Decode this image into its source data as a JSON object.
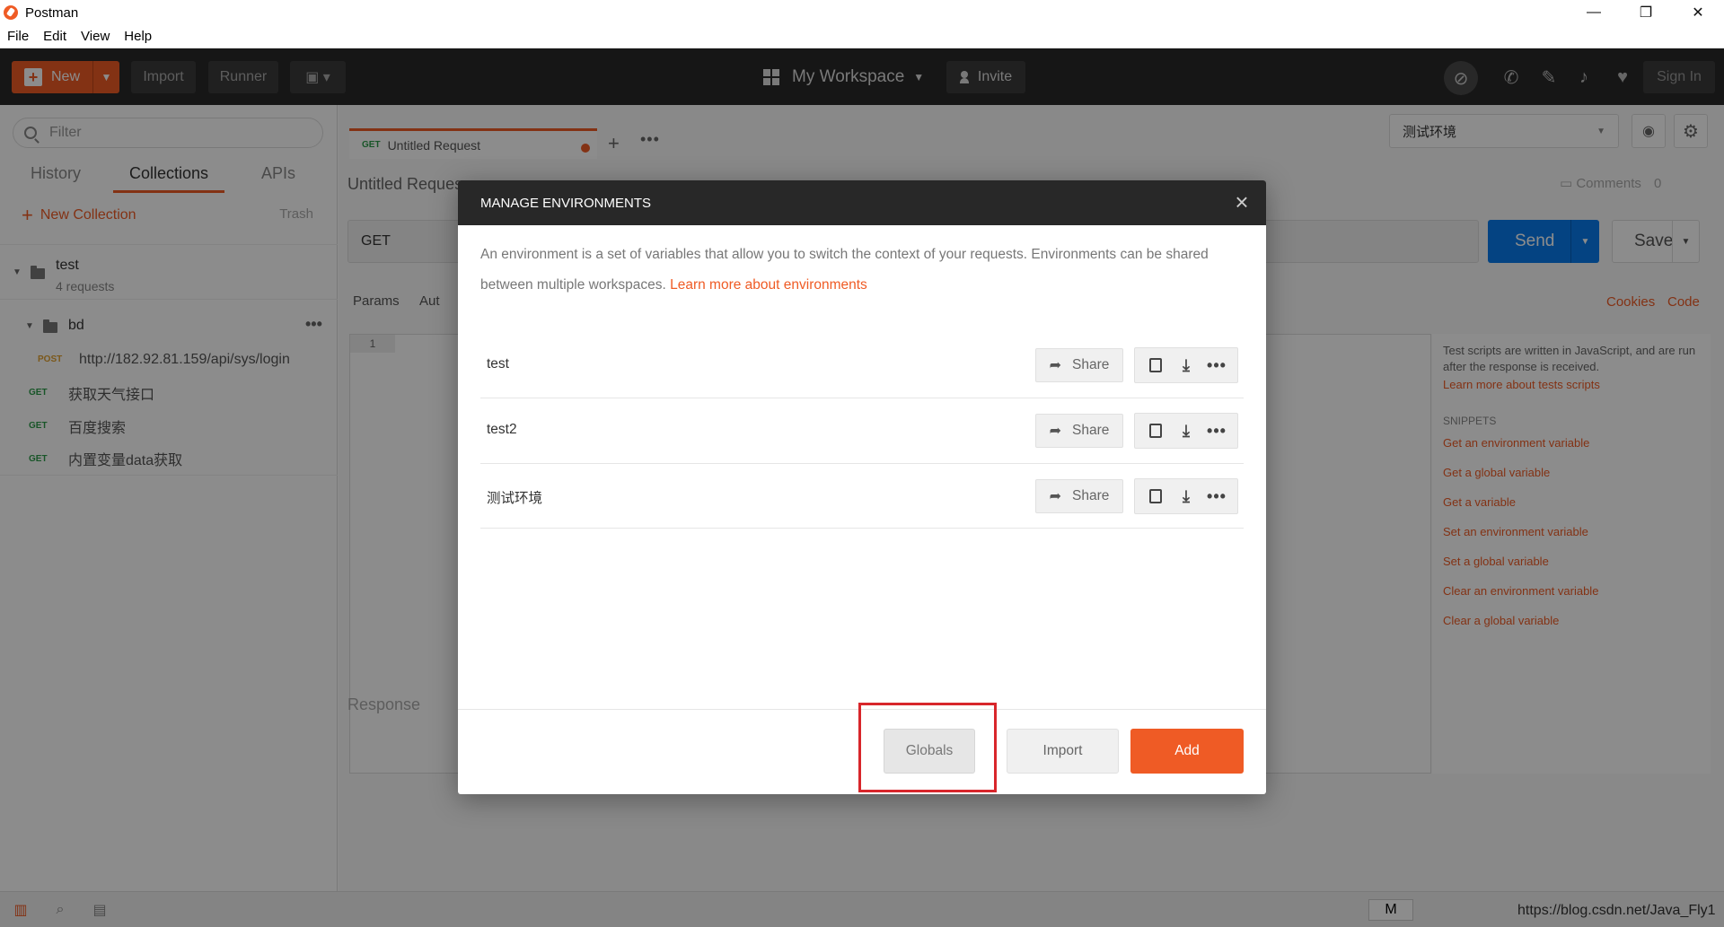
{
  "window": {
    "title": "Postman",
    "controls": [
      "—",
      "❐",
      "✕"
    ]
  },
  "menu": [
    "File",
    "Edit",
    "View",
    "Help"
  ],
  "header": {
    "new_label": "New",
    "import_label": "Import",
    "runner_label": "Runner",
    "workspace_label": "My Workspace",
    "invite_label": "Invite",
    "signin_label": "Sign In"
  },
  "sidebar": {
    "filter_placeholder": "Filter",
    "tabs": [
      "History",
      "Collections",
      "APIs"
    ],
    "active_tab": "Collections",
    "new_collection_label": "New Collection",
    "trash_label": "Trash",
    "collection": {
      "name": "test",
      "count": "4 requests",
      "folder": "bd",
      "requests": [
        {
          "method": "POST",
          "name": "http://182.92.81.159/api/sys/login"
        },
        {
          "method": "GET",
          "name": "获取天气接口"
        },
        {
          "method": "GET",
          "name": "百度搜索"
        },
        {
          "method": "GET",
          "name": "内置变量data获取"
        }
      ]
    }
  },
  "main": {
    "tab_method": "GET",
    "tab_label": "Untitled Request",
    "request_title": "Untitled Reques",
    "environment_selected": "测试环境",
    "comments_label": "Comments",
    "comments_count": "0",
    "url_method": "GET",
    "send_label": "Send",
    "save_label": "Save",
    "params_label": "Params",
    "auth_label": "Aut",
    "cookies_label": "Cookies",
    "code_label": "Code",
    "line_number": "1",
    "response_label": "Response",
    "snippets": {
      "description": "Test scripts are written in JavaScript, and are run after the response is received.",
      "learn_more": "Learn more about tests scripts",
      "heading": "SNIPPETS",
      "items": [
        "Get an environment variable",
        "Get a global variable",
        "Get a variable",
        "Set an environment variable",
        "Set a global variable",
        "Clear an environment variable",
        "Clear a global variable"
      ]
    }
  },
  "modal": {
    "title": "MANAGE ENVIRONMENTS",
    "description": "An environment is a set of variables that allow you to switch the context of your requests. Environments can be shared between multiple workspaces.",
    "learn_more": "Learn more about environments",
    "share_label": "Share",
    "environments": [
      "test",
      "test2",
      "测试环境"
    ],
    "globals_label": "Globals",
    "import_label": "Import",
    "add_label": "Add"
  },
  "bottom": {
    "badge": "M",
    "watermark": "https://blog.csdn.net/Java_Fly1"
  },
  "colors": {
    "accent": "#ef5b25",
    "send_blue": "#097bed",
    "header_dark": "#282828",
    "highlight_red": "#d8262b"
  }
}
